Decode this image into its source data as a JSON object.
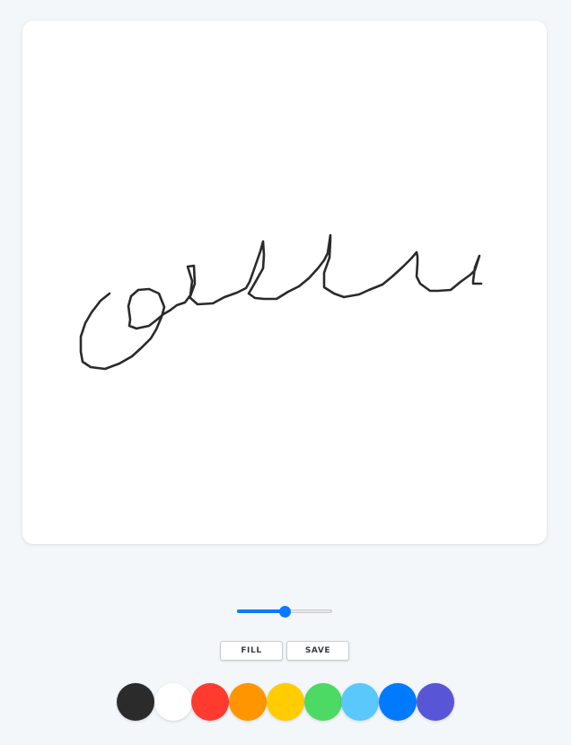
{
  "canvas": {
    "stroke_color": "#2a2a2a"
  },
  "brush": {
    "size_fraction": 0.5,
    "accent_color": "#0a7aff"
  },
  "buttons": {
    "fill_label": "FILL",
    "save_label": "SAVE"
  },
  "palette": [
    {
      "name": "black",
      "color": "#2b2b2b"
    },
    {
      "name": "white",
      "color": "#ffffff"
    },
    {
      "name": "red",
      "color": "#ff3b30"
    },
    {
      "name": "orange",
      "color": "#ff9500"
    },
    {
      "name": "yellow",
      "color": "#ffcc00"
    },
    {
      "name": "green",
      "color": "#4cd964"
    },
    {
      "name": "light-blue",
      "color": "#5ac8fa"
    },
    {
      "name": "blue",
      "color": "#007aff"
    },
    {
      "name": "purple",
      "color": "#5856d6"
    }
  ]
}
